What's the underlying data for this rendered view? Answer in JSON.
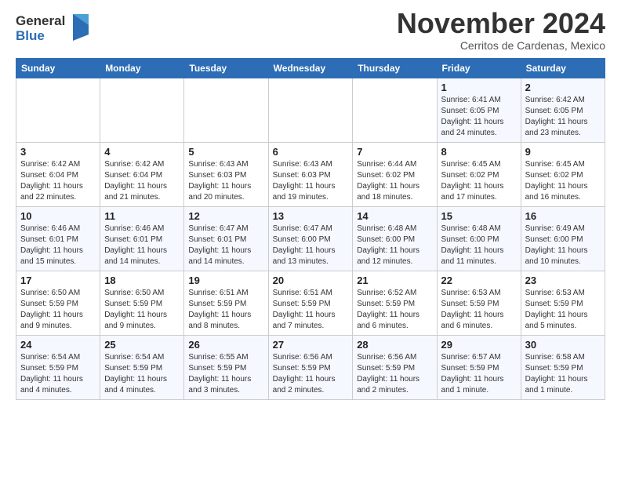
{
  "logo": {
    "general": "General",
    "blue": "Blue"
  },
  "header": {
    "month": "November 2024",
    "location": "Cerritos de Cardenas, Mexico"
  },
  "days_of_week": [
    "Sunday",
    "Monday",
    "Tuesday",
    "Wednesday",
    "Thursday",
    "Friday",
    "Saturday"
  ],
  "weeks": [
    [
      {
        "day": "",
        "info": ""
      },
      {
        "day": "",
        "info": ""
      },
      {
        "day": "",
        "info": ""
      },
      {
        "day": "",
        "info": ""
      },
      {
        "day": "",
        "info": ""
      },
      {
        "day": "1",
        "info": "Sunrise: 6:41 AM\nSunset: 6:05 PM\nDaylight: 11 hours and 24 minutes."
      },
      {
        "day": "2",
        "info": "Sunrise: 6:42 AM\nSunset: 6:05 PM\nDaylight: 11 hours and 23 minutes."
      }
    ],
    [
      {
        "day": "3",
        "info": "Sunrise: 6:42 AM\nSunset: 6:04 PM\nDaylight: 11 hours and 22 minutes."
      },
      {
        "day": "4",
        "info": "Sunrise: 6:42 AM\nSunset: 6:04 PM\nDaylight: 11 hours and 21 minutes."
      },
      {
        "day": "5",
        "info": "Sunrise: 6:43 AM\nSunset: 6:03 PM\nDaylight: 11 hours and 20 minutes."
      },
      {
        "day": "6",
        "info": "Sunrise: 6:43 AM\nSunset: 6:03 PM\nDaylight: 11 hours and 19 minutes."
      },
      {
        "day": "7",
        "info": "Sunrise: 6:44 AM\nSunset: 6:02 PM\nDaylight: 11 hours and 18 minutes."
      },
      {
        "day": "8",
        "info": "Sunrise: 6:45 AM\nSunset: 6:02 PM\nDaylight: 11 hours and 17 minutes."
      },
      {
        "day": "9",
        "info": "Sunrise: 6:45 AM\nSunset: 6:02 PM\nDaylight: 11 hours and 16 minutes."
      }
    ],
    [
      {
        "day": "10",
        "info": "Sunrise: 6:46 AM\nSunset: 6:01 PM\nDaylight: 11 hours and 15 minutes."
      },
      {
        "day": "11",
        "info": "Sunrise: 6:46 AM\nSunset: 6:01 PM\nDaylight: 11 hours and 14 minutes."
      },
      {
        "day": "12",
        "info": "Sunrise: 6:47 AM\nSunset: 6:01 PM\nDaylight: 11 hours and 14 minutes."
      },
      {
        "day": "13",
        "info": "Sunrise: 6:47 AM\nSunset: 6:00 PM\nDaylight: 11 hours and 13 minutes."
      },
      {
        "day": "14",
        "info": "Sunrise: 6:48 AM\nSunset: 6:00 PM\nDaylight: 11 hours and 12 minutes."
      },
      {
        "day": "15",
        "info": "Sunrise: 6:48 AM\nSunset: 6:00 PM\nDaylight: 11 hours and 11 minutes."
      },
      {
        "day": "16",
        "info": "Sunrise: 6:49 AM\nSunset: 6:00 PM\nDaylight: 11 hours and 10 minutes."
      }
    ],
    [
      {
        "day": "17",
        "info": "Sunrise: 6:50 AM\nSunset: 5:59 PM\nDaylight: 11 hours and 9 minutes."
      },
      {
        "day": "18",
        "info": "Sunrise: 6:50 AM\nSunset: 5:59 PM\nDaylight: 11 hours and 9 minutes."
      },
      {
        "day": "19",
        "info": "Sunrise: 6:51 AM\nSunset: 5:59 PM\nDaylight: 11 hours and 8 minutes."
      },
      {
        "day": "20",
        "info": "Sunrise: 6:51 AM\nSunset: 5:59 PM\nDaylight: 11 hours and 7 minutes."
      },
      {
        "day": "21",
        "info": "Sunrise: 6:52 AM\nSunset: 5:59 PM\nDaylight: 11 hours and 6 minutes."
      },
      {
        "day": "22",
        "info": "Sunrise: 6:53 AM\nSunset: 5:59 PM\nDaylight: 11 hours and 6 minutes."
      },
      {
        "day": "23",
        "info": "Sunrise: 6:53 AM\nSunset: 5:59 PM\nDaylight: 11 hours and 5 minutes."
      }
    ],
    [
      {
        "day": "24",
        "info": "Sunrise: 6:54 AM\nSunset: 5:59 PM\nDaylight: 11 hours and 4 minutes."
      },
      {
        "day": "25",
        "info": "Sunrise: 6:54 AM\nSunset: 5:59 PM\nDaylight: 11 hours and 4 minutes."
      },
      {
        "day": "26",
        "info": "Sunrise: 6:55 AM\nSunset: 5:59 PM\nDaylight: 11 hours and 3 minutes."
      },
      {
        "day": "27",
        "info": "Sunrise: 6:56 AM\nSunset: 5:59 PM\nDaylight: 11 hours and 2 minutes."
      },
      {
        "day": "28",
        "info": "Sunrise: 6:56 AM\nSunset: 5:59 PM\nDaylight: 11 hours and 2 minutes."
      },
      {
        "day": "29",
        "info": "Sunrise: 6:57 AM\nSunset: 5:59 PM\nDaylight: 11 hours and 1 minute."
      },
      {
        "day": "30",
        "info": "Sunrise: 6:58 AM\nSunset: 5:59 PM\nDaylight: 11 hours and 1 minute."
      }
    ]
  ]
}
